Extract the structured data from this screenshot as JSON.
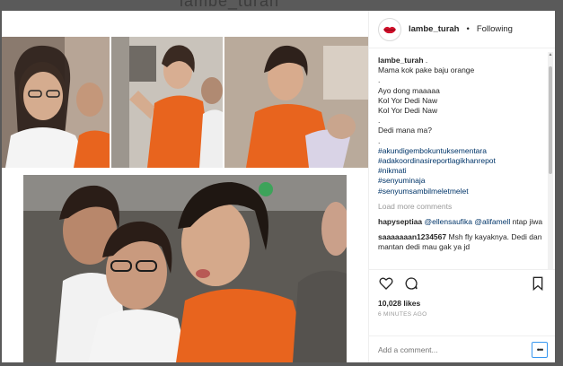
{
  "backdrop": {
    "title": "lambe_turah"
  },
  "post": {
    "username": "lambe_turah",
    "separator": "•",
    "follow_status": "Following",
    "caption_user": "lambe_turah",
    "caption_lines": [
      ".",
      "Mama kok pake baju orange",
      ".",
      "Ayo dong maaaaa",
      "Kol Yor Dedi Naw",
      "Kol Yor Dedi Naw",
      ".",
      "Dedi mana ma?",
      "."
    ],
    "hashtags": [
      "#akundigembokuntuksementara",
      "#adakoordinasireportlagikhanrepot",
      "#nikmati",
      "#senyuminaja",
      "#senyumsambilmeletmelet"
    ],
    "load_more": "Load more comments",
    "comments": [
      {
        "user": "hapyseptiaa",
        "mentions": "@ellensaufika @alifamell",
        "text": "ntap jiwa"
      },
      {
        "user": "saaaaaaan1234567",
        "text": "Msh fly kayaknya. Dedi dan mantan dedi mau gak ya jd"
      }
    ],
    "likes": "10,028 likes",
    "time_ago": "6 MINUTES AGO",
    "comment_placeholder": "Add a comment...",
    "more_label": "•••"
  },
  "icons": {
    "avatar": "red-lips-icon",
    "like": "heart-icon",
    "comment": "speech-bubble-icon",
    "save": "bookmark-icon",
    "more": "ellipsis-icon"
  },
  "colors": {
    "backdrop": "#5a5a5a",
    "prison_orange": "#e8641e",
    "link": "#003569",
    "focus_blue": "#3897f0"
  }
}
